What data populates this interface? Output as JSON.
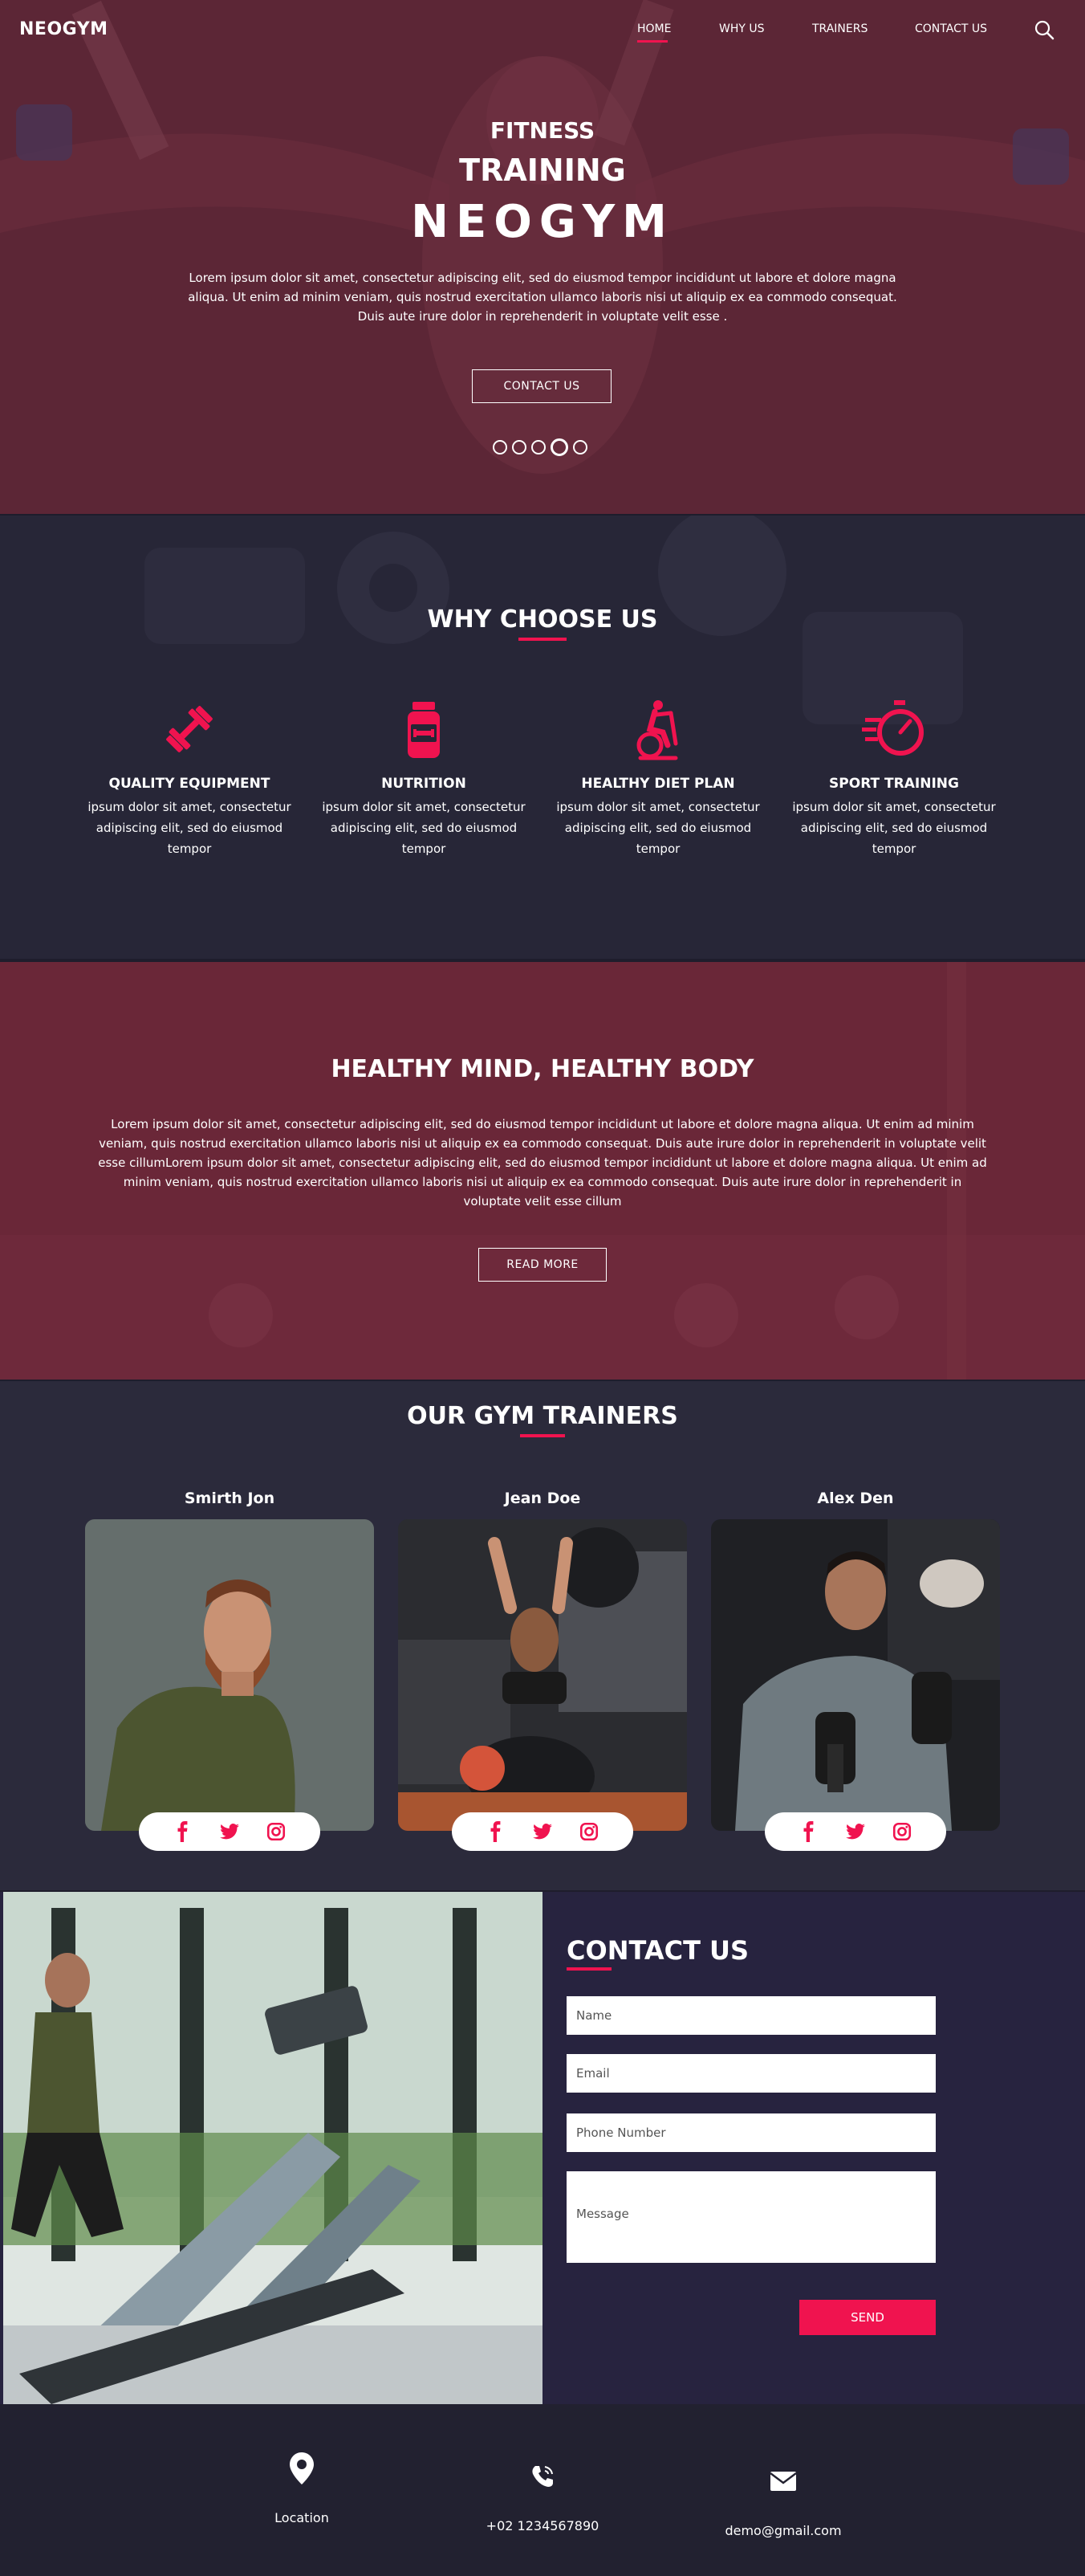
{
  "brand": "NEOGYM",
  "nav": {
    "items": [
      {
        "label": "HOME"
      },
      {
        "label": "WHY US"
      },
      {
        "label": "TRAINERS"
      },
      {
        "label": "CONTACT US"
      }
    ]
  },
  "hero": {
    "line1": "FITNESS",
    "line2": "TRAINING",
    "line3": "NEOGYM",
    "text": "Lorem ipsum dolor sit amet, consectetur adipiscing elit, sed do eiusmod tempor incididunt ut labore et dolore magna aliqua. Ut enim ad minim veniam, quis nostrud exercitation ullamco laboris nisi ut aliquip ex ea commodo consequat. Duis aute irure dolor in reprehenderit in voluptate velit esse .",
    "cta": "CONTACT US",
    "slides": 5,
    "active_slide": 4
  },
  "why": {
    "title": "WHY CHOOSE US",
    "features": [
      {
        "icon": "dumbbell-icon",
        "title": "QUALITY EQUIPMENT",
        "text": "ipsum dolor sit amet, consectetur adipiscing elit, sed do eiusmod tempor"
      },
      {
        "icon": "supplement-jar-icon",
        "title": "NUTRITION",
        "text": "ipsum dolor sit amet, consectetur adipiscing elit, sed do eiusmod tempor"
      },
      {
        "icon": "exercise-bike-icon",
        "title": "HEALTHY DIET PLAN",
        "text": "ipsum dolor sit amet, consectetur adipiscing elit, sed do eiusmod tempor"
      },
      {
        "icon": "stopwatch-icon",
        "title": "SPORT TRAINING",
        "text": "ipsum dolor sit amet, consectetur adipiscing elit, sed do eiusmod tempor"
      }
    ]
  },
  "health": {
    "title": "HEALTHY MIND, HEALTHY BODY",
    "text": "Lorem ipsum dolor sit amet, consectetur adipiscing elit, sed do eiusmod tempor incididunt ut labore et dolore magna aliqua. Ut enim ad minim veniam, quis nostrud exercitation ullamco laboris nisi ut aliquip ex ea commodo consequat. Duis aute irure dolor in reprehenderit in voluptate velit esse cillumLorem ipsum dolor sit amet, consectetur adipiscing elit, sed do eiusmod tempor incididunt ut labore et dolore magna aliqua. Ut enim ad minim veniam, quis nostrud exercitation ullamco laboris nisi ut aliquip ex ea commodo consequat. Duis aute irure dolor in reprehenderit in voluptate velit esse cillum",
    "cta": "READ MORE"
  },
  "trainers": {
    "title": "OUR GYM TRAINERS",
    "list": [
      {
        "name": "Smirth Jon",
        "social": [
          "facebook-icon",
          "twitter-icon",
          "instagram-icon"
        ]
      },
      {
        "name": "Jean Doe",
        "social": [
          "facebook-icon",
          "twitter-icon",
          "instagram-icon"
        ]
      },
      {
        "name": "Alex Den",
        "social": [
          "facebook-icon",
          "twitter-icon",
          "instagram-icon"
        ]
      }
    ]
  },
  "contact": {
    "title": "CONTACT US",
    "name_placeholder": "Name",
    "email_placeholder": "Email",
    "phone_placeholder": "Phone Number",
    "message_placeholder": "Message",
    "send": "SEND"
  },
  "footer": {
    "location": "Location",
    "phone": "+02 1234567890",
    "email": "demo@gmail.com"
  },
  "colors": {
    "accent": "#f0134f",
    "hero_bg": "#5a2535",
    "dark_bg": "#262535",
    "contact_bg": "#27233f"
  }
}
